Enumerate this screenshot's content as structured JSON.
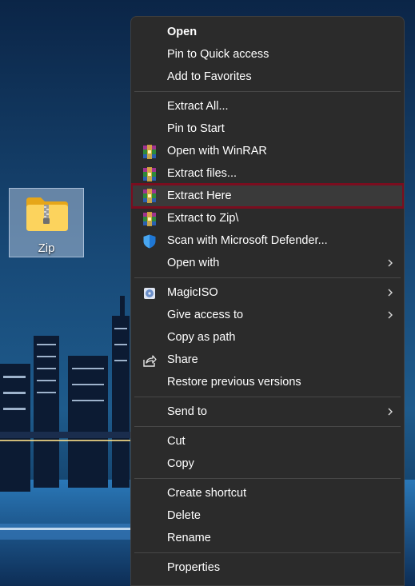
{
  "desktop": {
    "icon_label": "Zip"
  },
  "menu": {
    "items": [
      {
        "label": "Open"
      },
      {
        "label": "Pin to Quick access"
      },
      {
        "label": "Add to Favorites"
      },
      {
        "label": "Extract All..."
      },
      {
        "label": "Pin to Start"
      },
      {
        "label": "Open with WinRAR",
        "icon": "winrar-icon"
      },
      {
        "label": "Extract files...",
        "icon": "winrar-icon"
      },
      {
        "label": "Extract Here",
        "icon": "winrar-icon"
      },
      {
        "label": "Extract to Zip\\",
        "icon": "winrar-icon"
      },
      {
        "label": "Scan with Microsoft Defender...",
        "icon": "defender-shield-icon"
      },
      {
        "label": "Open with"
      },
      {
        "label": "MagicISO",
        "icon": "magiciso-icon"
      },
      {
        "label": "Give access to"
      },
      {
        "label": "Copy as path"
      },
      {
        "label": "Share",
        "icon": "share-icon"
      },
      {
        "label": "Restore previous versions"
      },
      {
        "label": "Send to"
      },
      {
        "label": "Cut"
      },
      {
        "label": "Copy"
      },
      {
        "label": "Create shortcut"
      },
      {
        "label": "Delete"
      },
      {
        "label": "Rename"
      },
      {
        "label": "Properties"
      }
    ]
  },
  "colors": {
    "menu_background": "#2b2b2b",
    "highlight_border": "#7a0d1f",
    "separator": "#474747"
  }
}
